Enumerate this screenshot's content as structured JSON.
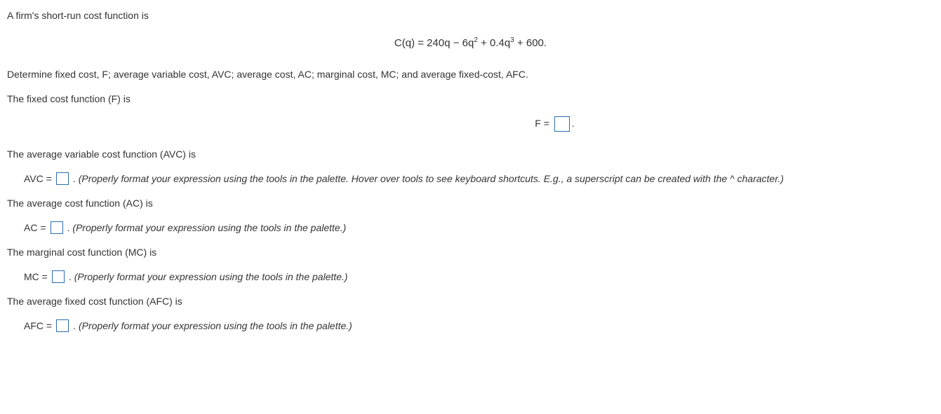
{
  "intro": "A firm's short-run cost function is",
  "cost_eq": {
    "prefix": "C(q) = 240q − 6q",
    "exp1": "2",
    "mid": " + 0.4q",
    "exp2": "3",
    "suffix": " + 600."
  },
  "task": "Determine fixed cost, F; average variable cost, AVC; average cost, AC; marginal cost, MC; and average fixed-cost, AFC.",
  "f_prompt": "The fixed cost function (F) is",
  "f_eq_label": "F =",
  "f_period": ".",
  "avc_prompt": "The average variable cost function (AVC) is",
  "avc_label": "AVC =",
  "avc_period": ".",
  "avc_hint": "(Properly format your expression using the tools in the palette. Hover over tools to see keyboard shortcuts. E.g., a superscript can be created with the ^ character.)",
  "ac_prompt": "The average cost function (AC) is",
  "ac_label": "AC =",
  "ac_period": ".",
  "ac_hint": "(Properly format your expression using the tools in the palette.)",
  "mc_prompt": "The marginal cost function (MC) is",
  "mc_label": "MC =",
  "mc_period": ".",
  "mc_hint": "(Properly format your expression using the tools in the palette.)",
  "afc_prompt": "The average fixed cost function (AFC) is",
  "afc_label": "AFC =",
  "afc_period": ".",
  "afc_hint": "(Properly format your expression using the tools in the palette.)"
}
